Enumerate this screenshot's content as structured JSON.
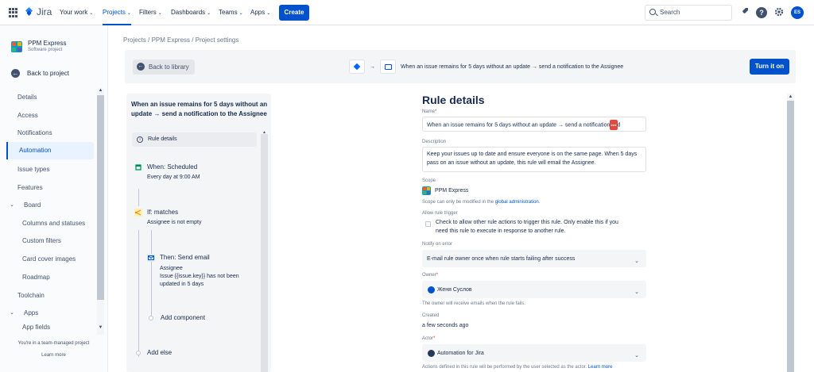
{
  "topbar": {
    "logo_text": "Jira",
    "nav": [
      {
        "label": "Your work",
        "active": false
      },
      {
        "label": "Projects",
        "active": true
      },
      {
        "label": "Filters",
        "active": false
      },
      {
        "label": "Dashboards",
        "active": false
      },
      {
        "label": "Teams",
        "active": false
      },
      {
        "label": "Apps",
        "active": false
      }
    ],
    "create_label": "Create",
    "search_placeholder": "Search",
    "avatar_initials": "ES"
  },
  "sidebar": {
    "project_name": "PPM Express",
    "project_type": "Software project",
    "back_label": "Back to project",
    "items": [
      {
        "label": "Details"
      },
      {
        "label": "Access"
      },
      {
        "label": "Notifications"
      },
      {
        "label": "Automation"
      },
      {
        "label": "Issue types"
      },
      {
        "label": "Features"
      },
      {
        "label": "Board"
      },
      {
        "label": "Columns and statuses"
      },
      {
        "label": "Custom filters"
      },
      {
        "label": "Card cover images"
      },
      {
        "label": "Roadmap"
      },
      {
        "label": "Toolchain"
      },
      {
        "label": "Apps"
      },
      {
        "label": "App fields"
      }
    ],
    "footer_text": "You're in a team-managed project",
    "footer_link": "Learn more"
  },
  "breadcrumb": "Projects  /  PPM Express  /  Project settings",
  "banner": {
    "back_label": "Back to library",
    "summary": "When an issue remains for 5 days without an update → send a notification to the Assignee",
    "turn_on_label": "Turn it on"
  },
  "left_panel": {
    "title": "When an issue remains for 5 days without an update → send a notification to the Assignee",
    "rule_details_label": "Rule details",
    "trigger_title": "When: Scheduled",
    "trigger_desc": "Every day at 9:00 AM",
    "condition_title": "If: matches",
    "condition_desc": "Assignee is not empty",
    "action_title": "Then: Send email",
    "action_desc_1": "Assignee",
    "action_desc_2": "Issue {{issue.key}} has not been",
    "action_desc_3": "updated in 5 days",
    "add_component": "Add component",
    "add_else": "Add else"
  },
  "rule_details": {
    "title": "Rule details",
    "name_label": "Name",
    "name_value": "When an issue remains for 5 days without an update → send a notification",
    "name_tail": "d",
    "description_label": "Description",
    "description_value": "Keep your issues up to date and ensure everyone is on the same page. When 5 days pass on an issue without an update, this rule will email the Assignee.",
    "scope_label": "Scope",
    "scope_value": "PPM Express",
    "scope_note_prefix": "Scope can only be modified in the",
    "scope_note_link": "global administration",
    "allow_trigger_label": "Allow rule trigger",
    "allow_trigger_text_1": "Check to allow other rule actions to trigger this rule. Only enable this if you",
    "allow_trigger_text_2": "need this rule to execute in response to another rule.",
    "notify_label": "Notify on error",
    "notify_value": "E-mail rule owner once when rule starts failing after success",
    "owner_label": "Owner",
    "owner_value": "Женя Суслов",
    "owner_note": "The owner will receive emails when the rule fails.",
    "created_label": "Created",
    "created_value": "a few seconds ago",
    "actor_label": "Actor",
    "actor_value": "Automation for Jira",
    "actor_note_prefix": "Actions defined in this rule will be performed by the user selected as the actor.",
    "actor_note_link": "Learn more"
  },
  "colors": {
    "brand": "#0052cc",
    "text": "#172b4d",
    "muted": "#6b778c"
  }
}
